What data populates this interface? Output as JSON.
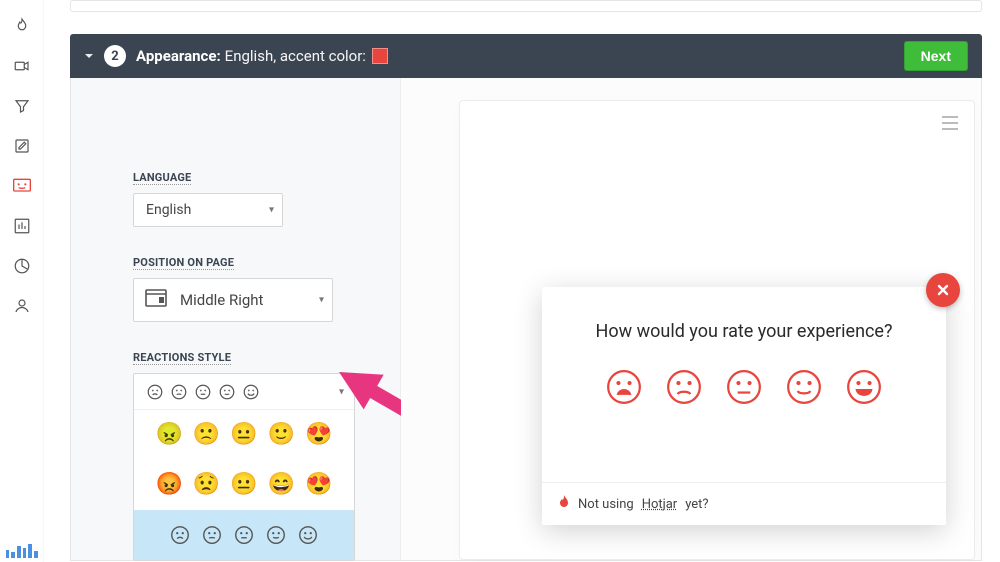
{
  "nav": {
    "items": [
      {
        "name": "fire-icon"
      },
      {
        "name": "video-icon"
      },
      {
        "name": "funnel-icon"
      },
      {
        "name": "edit-icon"
      },
      {
        "name": "feedback-icon"
      },
      {
        "name": "bar-chart-icon"
      },
      {
        "name": "pie-chart-icon"
      },
      {
        "name": "user-icon"
      }
    ]
  },
  "header": {
    "step_number": "2",
    "title_label": "Appearance:",
    "subtitle": "English, accent color:",
    "accent_color": "#e8453e",
    "next_label": "Next"
  },
  "settings": {
    "language_label": "LANGUAGE",
    "language_value": "English",
    "position_label": "POSITION ON PAGE",
    "position_value": "Middle Right",
    "reactions_label": "REACTIONS STYLE",
    "style_rows": [
      {
        "kind": "square-yellow",
        "emojis": [
          "😠",
          "🙁",
          "😐",
          "🙂",
          "😍"
        ]
      },
      {
        "kind": "round-emoji",
        "emojis": [
          "😡",
          "😟",
          "😐",
          "😄",
          "😍"
        ]
      },
      {
        "kind": "outline-gray"
      }
    ]
  },
  "preview": {
    "question": "How would you rate your experience?",
    "footer_prefix": "Not using",
    "footer_link": "Hotjar",
    "footer_suffix": "yet?"
  }
}
